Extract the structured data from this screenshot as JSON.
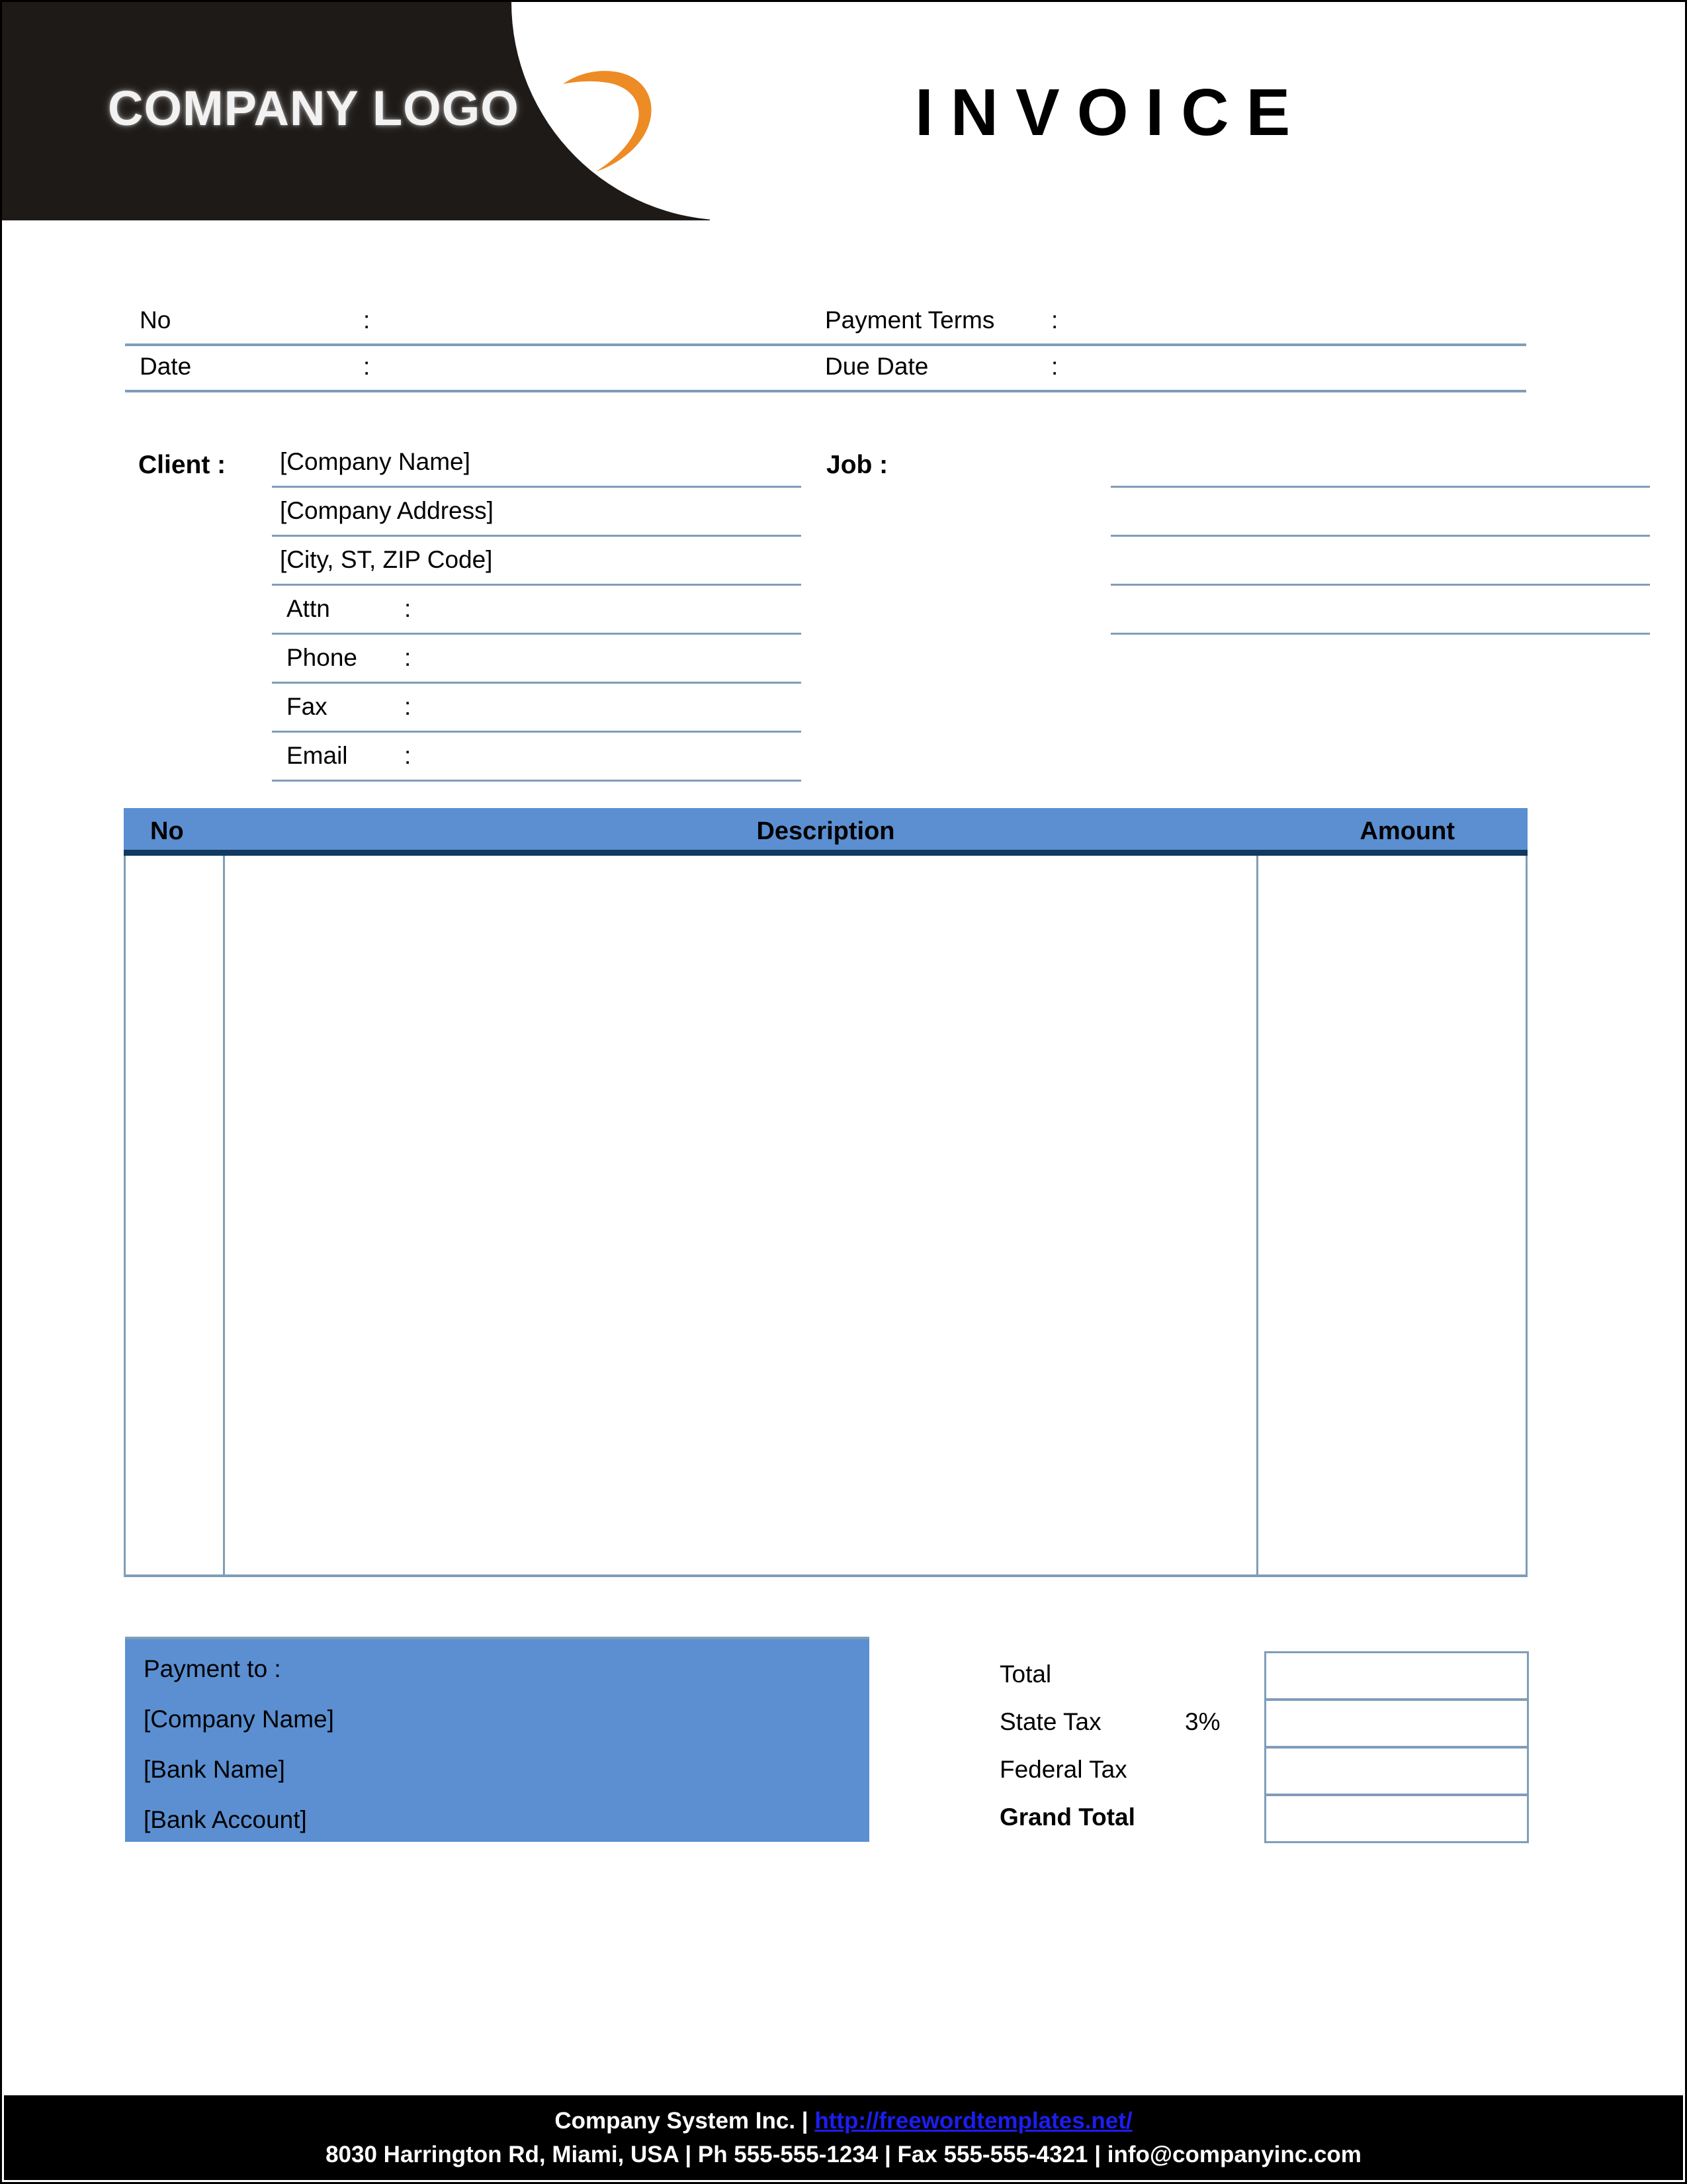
{
  "header": {
    "logo_text": "COMPANY LOGO",
    "logo_swoosh_color": "#ED8B24",
    "band_color": "#1E1A17",
    "title": "INVOICE"
  },
  "meta": {
    "no_label": "No",
    "no_colon": ":",
    "no_value": "",
    "date_label": "Date",
    "date_colon": ":",
    "date_value": "",
    "payment_terms_label": "Payment  Terms",
    "payment_terms_colon": ":",
    "payment_terms_value": "",
    "due_date_label": "Due Date",
    "due_date_colon": ":",
    "due_date_value": ""
  },
  "client": {
    "label": "Client  :",
    "lines": [
      {
        "kind": "value",
        "text": "[Company Name]"
      },
      {
        "kind": "value",
        "text": "[Company Address]"
      },
      {
        "kind": "value",
        "text": "[City, ST, ZIP Code]"
      },
      {
        "kind": "field",
        "label": "Attn",
        "colon": ":",
        "value": ""
      },
      {
        "kind": "field",
        "label": "Phone",
        "colon": ":",
        "value": ""
      },
      {
        "kind": "field",
        "label": "Fax",
        "colon": ":",
        "value": ""
      },
      {
        "kind": "field",
        "label": "Email",
        "colon": ":",
        "value": ""
      }
    ]
  },
  "job": {
    "label": "Job  :",
    "lines": [
      "",
      "",
      "",
      ""
    ]
  },
  "items_table": {
    "header_bg": "#5B8FD1",
    "header_rule": "#12395F",
    "border_color": "#7F9DB9",
    "columns": [
      "No",
      "Description",
      "Amount"
    ],
    "rows": []
  },
  "payment": {
    "bg": "#5B8FD1",
    "lines": [
      "Payment to :",
      "[Company Name]",
      "[Bank Name]",
      "[Bank Account]"
    ]
  },
  "totals": {
    "rows": [
      {
        "label": "Total",
        "pct": "",
        "value": "",
        "bold": false
      },
      {
        "label": "State Tax",
        "pct": "3%",
        "value": "",
        "bold": false
      },
      {
        "label": "Federal Tax",
        "pct": "",
        "value": "",
        "bold": false
      },
      {
        "label": "Grand Total",
        "pct": "",
        "value": "",
        "bold": true
      }
    ]
  },
  "footer": {
    "bg": "#000000",
    "line1_company": "Company System Inc. ",
    "line1_sep": "| ",
    "line1_url": "http://freewordtemplates.net/",
    "line1_url_color": "#1D1DF0",
    "line2": "8030 Harrington Rd, Miami, USA | Ph 555-555-1234 | Fax 555-555-4321 | info@companyinc.com"
  }
}
